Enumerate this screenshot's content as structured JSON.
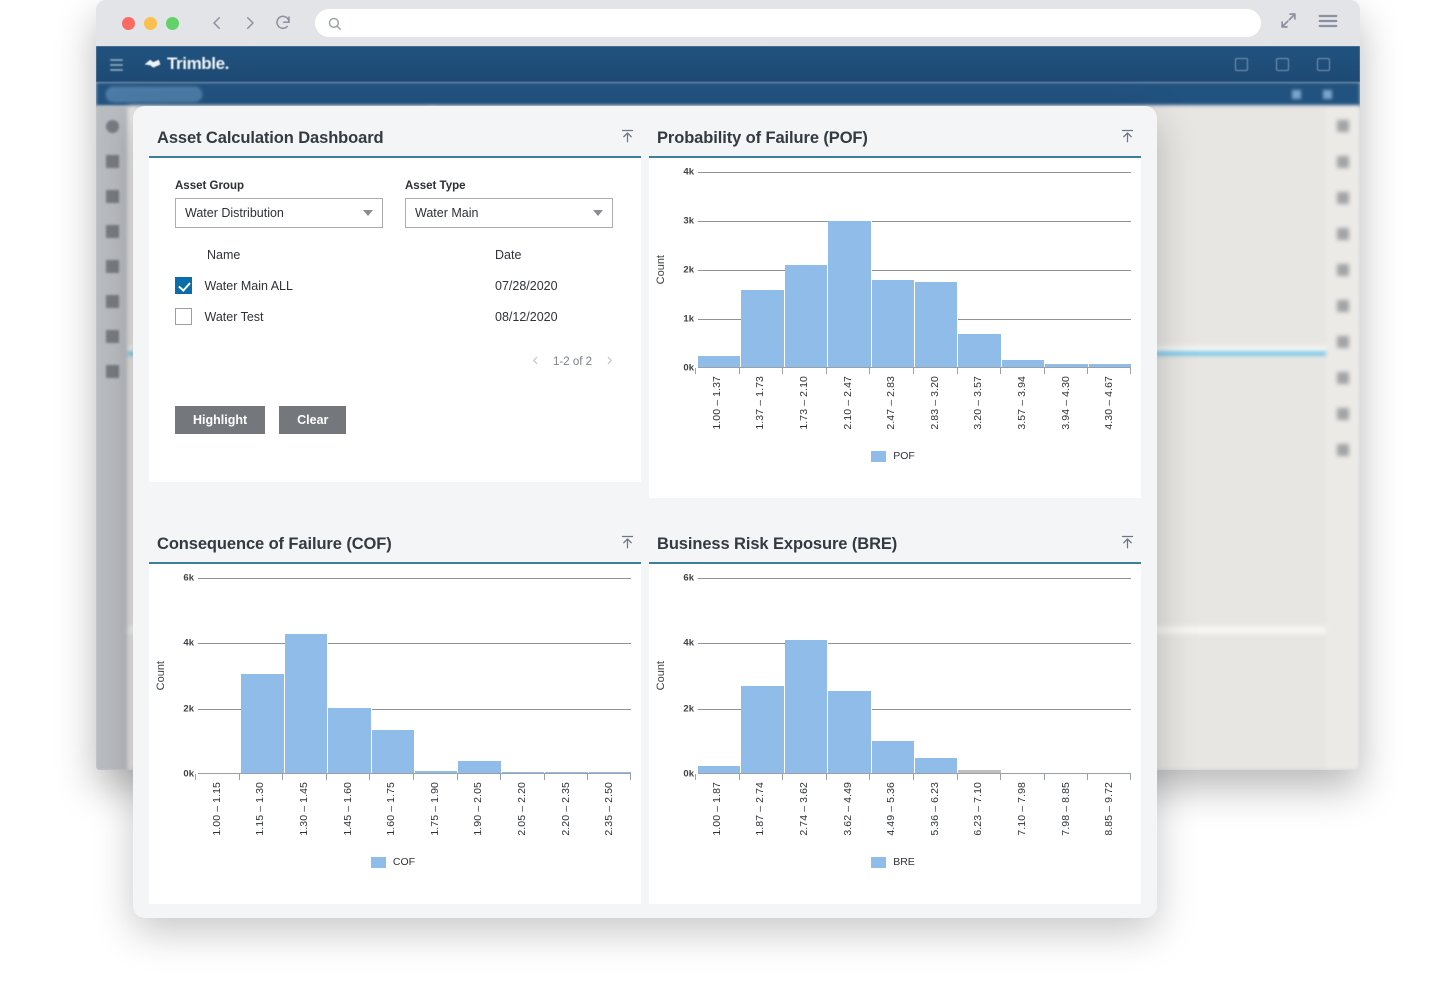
{
  "browser": {
    "url_value": "",
    "url_placeholder": "",
    "controls": {
      "back": "back-icon",
      "forward": "forward-icon",
      "reload": "reload-icon",
      "search": "search-icon",
      "expand": "expand-icon",
      "menu": "menu-icon"
    }
  },
  "app": {
    "brand": "Trimble.",
    "tab_label": ""
  },
  "dashboard": {
    "title": "Asset Calculation Dashboard",
    "asset_group": {
      "label": "Asset Group",
      "value": "Water Distribution"
    },
    "asset_type": {
      "label": "Asset Type",
      "value": "Water Main"
    },
    "table": {
      "columns": [
        "Name",
        "Date"
      ],
      "rows": [
        {
          "checked": true,
          "name": "Water Main ALL",
          "date": "07/28/2020"
        },
        {
          "checked": false,
          "name": "Water Test",
          "date": "08/12/2020"
        }
      ]
    },
    "pager": {
      "text": "1-2 of 2",
      "prev": "chevron-left-icon",
      "next": "chevron-right-icon"
    },
    "buttons": {
      "highlight": "Highlight",
      "clear": "Clear"
    }
  },
  "colors": {
    "bar_blue": "#8fbce8",
    "bar_gray": "#bfbfbf",
    "accent_underline": "#3c7e9c",
    "button_gray": "#74777c",
    "checkbox_blue": "#0a6ca8",
    "appbar_blue": "#1d4a74"
  },
  "chart_data": [
    {
      "id": "pof",
      "type": "bar",
      "title": "Probability of Failure (POF)",
      "xlabel": "",
      "ylabel": "Count",
      "ylim": [
        0,
        4000
      ],
      "yticks": [
        0,
        1000,
        2000,
        3000,
        4000
      ],
      "ytick_labels": [
        "0k",
        "1k",
        "2k",
        "3k",
        "4k"
      ],
      "grid": true,
      "legend": [
        {
          "name": "POF",
          "color": "#8fbce8"
        }
      ],
      "legend_position": "bottom",
      "categories": [
        "1.00 – 1.37",
        "1.37 – 1.73",
        "1.73 – 2.10",
        "2.10 – 2.47",
        "2.47 – 2.83",
        "2.83 – 3.20",
        "3.20 – 3.57",
        "3.57 – 3.94",
        "3.94 – 4.30",
        "4.30 – 4.67"
      ],
      "values": [
        250,
        1600,
        2100,
        3000,
        1800,
        1750,
        700,
        170,
        80,
        80
      ],
      "bar_colors": [
        "#8fbce8",
        "#8fbce8",
        "#8fbce8",
        "#8fbce8",
        "#8fbce8",
        "#8fbce8",
        "#8fbce8",
        "#8fbce8",
        "#8fbce8",
        "#8fbce8"
      ]
    },
    {
      "id": "cof",
      "type": "bar",
      "title": "Consequence of Failure (COF)",
      "xlabel": "",
      "ylabel": "Count",
      "ylim": [
        0,
        6000
      ],
      "yticks": [
        0,
        2000,
        4000,
        6000
      ],
      "ytick_labels": [
        "0k",
        "2k",
        "4k",
        "6k"
      ],
      "grid": true,
      "legend": [
        {
          "name": "COF",
          "color": "#8fbce8"
        }
      ],
      "legend_position": "bottom",
      "categories": [
        "1.00 – 1.15",
        "1.15 – 1.30",
        "1.30 – 1.45",
        "1.45 – 1.60",
        "1.60 – 1.75",
        "1.75 – 1.90",
        "1.90 – 2.05",
        "2.05 – 2.20",
        "2.20 – 2.35",
        "2.35 – 2.50"
      ],
      "values": [
        0,
        3050,
        4300,
        2020,
        1350,
        100,
        400,
        50,
        50,
        50
      ],
      "bar_colors": [
        "#8fbce8",
        "#8fbce8",
        "#8fbce8",
        "#8fbce8",
        "#8fbce8",
        "#8fbce8",
        "#8fbce8",
        "#8fbce8",
        "#8fbce8",
        "#8fbce8"
      ]
    },
    {
      "id": "bre",
      "type": "bar",
      "title": "Business Risk Exposure (BRE)",
      "xlabel": "",
      "ylabel": "Count",
      "ylim": [
        0,
        6000
      ],
      "yticks": [
        0,
        2000,
        4000,
        6000
      ],
      "ytick_labels": [
        "0k",
        "2k",
        "4k",
        "6k"
      ],
      "grid": true,
      "legend": [
        {
          "name": "BRE",
          "color": "#8fbce8"
        }
      ],
      "legend_position": "bottom",
      "categories": [
        "1.00 – 1.87",
        "1.87 – 2.74",
        "2.74 – 3.62",
        "3.62 – 4.49",
        "4.49 – 5.36",
        "5.36 – 6.23",
        "6.23 – 7.10",
        "7.10 – 7.98",
        "7.98 – 8.85",
        "8.85 – 9.72"
      ],
      "values": [
        250,
        2700,
        4100,
        2550,
        1000,
        480,
        130,
        40,
        40,
        40
      ],
      "bar_colors": [
        "#8fbce8",
        "#8fbce8",
        "#8fbce8",
        "#8fbce8",
        "#8fbce8",
        "#8fbce8",
        "#bfbfbf",
        "#bfbfbf",
        "#bfbfbf",
        "#bfbfbf"
      ]
    }
  ]
}
